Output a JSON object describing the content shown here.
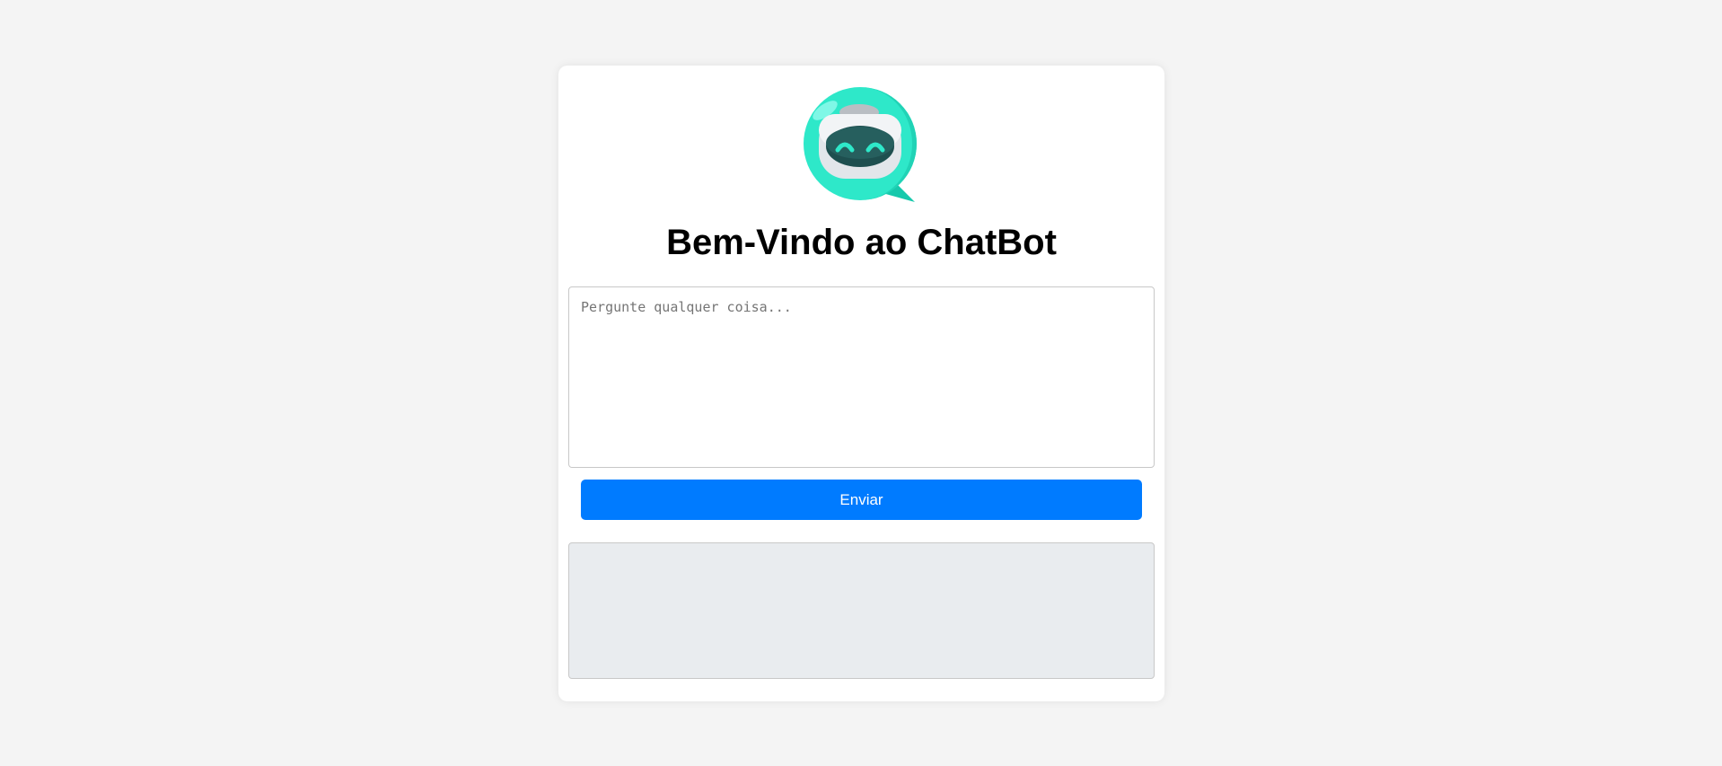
{
  "page": {
    "title": "Bem-Vindo ao ChatBot",
    "logo_icon": "robot-chat-bubble-icon"
  },
  "question": {
    "value": "",
    "placeholder": "Pergunte qualquer coisa..."
  },
  "send_button": {
    "label": "Enviar"
  },
  "response": {
    "text": ""
  },
  "colors": {
    "page_background": "#f4f4f4",
    "card_background": "#ffffff",
    "button_primary": "#007bff",
    "response_background": "#e9ecef",
    "logo_teal": "#2ee8c9",
    "logo_visor": "#1e4f4f"
  }
}
